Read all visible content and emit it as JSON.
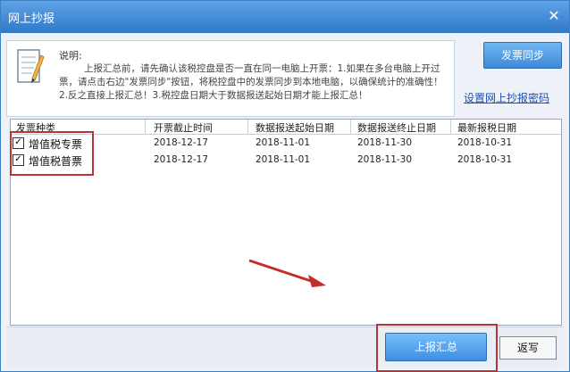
{
  "window": {
    "title": "网上抄报",
    "close_symbol": "✕"
  },
  "info": {
    "label": "说明:",
    "text": "上报汇总前，请先确认该税控盘是否一直在同一电脑上开票：1.如果在多台电脑上开过票，请点击右边\"发票同步\"按钮，将税控盘中的发票同步到本地电脑，以确保统计的准确性！2.反之直接上报汇总！3.税控盘日期大于数据报送起始日期才能上报汇总！"
  },
  "actions": {
    "sync_label": "发票同步",
    "password_link": "设置网上抄报密码",
    "submit_label": "上报汇总",
    "back_label": "返写"
  },
  "table": {
    "headers": [
      "发票种类",
      "开票截止时间",
      "数据报送起始日期",
      "数据报送终止日期",
      "最新报税日期"
    ],
    "rows": [
      {
        "checked": true,
        "type": "增值税专票",
        "deadline": "2018-12-17",
        "start": "2018-11-01",
        "end": "2018-11-30",
        "latest": "2018-10-31"
      },
      {
        "checked": true,
        "type": "增值税普票",
        "deadline": "2018-12-17",
        "start": "2018-11-01",
        "end": "2018-11-30",
        "latest": "2018-10-31"
      }
    ]
  },
  "colors": {
    "highlight": "#b83535",
    "title_bar": "#2f79c8",
    "accent": "#3e8ee0"
  },
  "icons": {
    "note": "note-pencil-icon",
    "checkbox": "checkmark-icon",
    "arrow": "red-arrow-icon"
  }
}
